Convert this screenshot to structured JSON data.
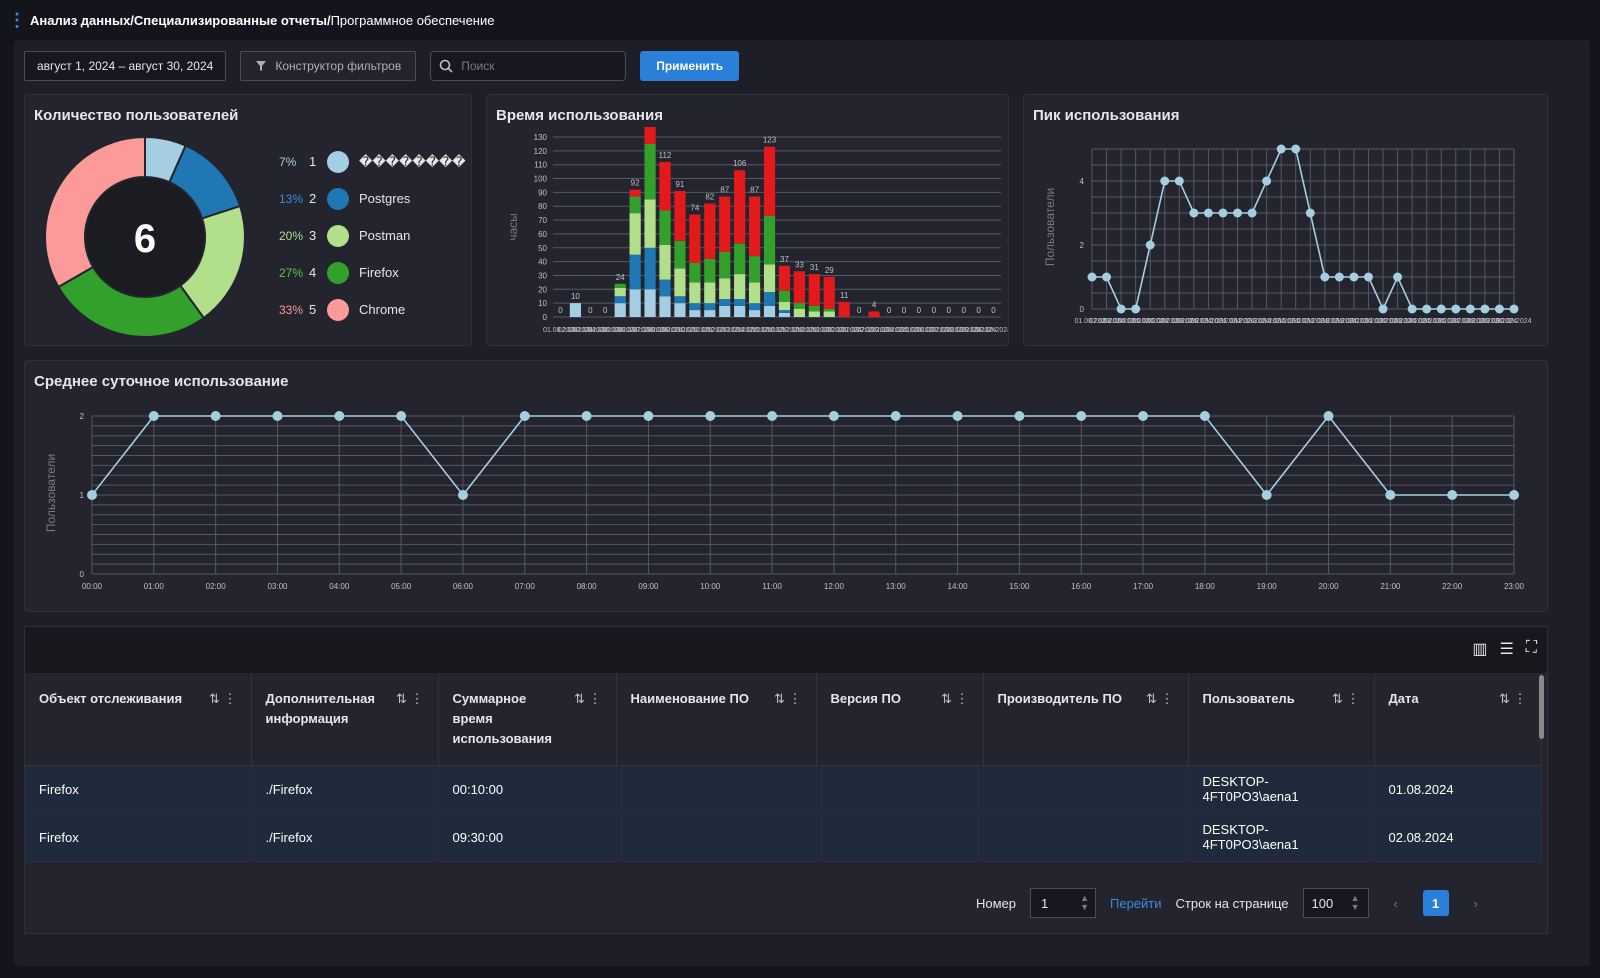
{
  "breadcrumb": {
    "path": "Анализ данных/Специализированные отчеты/",
    "current": "Программное обеспечение"
  },
  "toolbar": {
    "date_range": "август 1, 2024 – август 30, 2024",
    "filter_label": "Конструктор фильтров",
    "search_placeholder": "Поиск",
    "apply_label": "Применить"
  },
  "users_card": {
    "title": "Количество пользователей",
    "total": "6",
    "items": [
      {
        "pct": "7%",
        "num": "1",
        "name": "��������",
        "color": "#a6cee3"
      },
      {
        "pct": "13%",
        "num": "2",
        "name": "Postgres",
        "color": "#1f78b4"
      },
      {
        "pct": "20%",
        "num": "3",
        "name": "Postman",
        "color": "#b2df8a"
      },
      {
        "pct": "27%",
        "num": "4",
        "name": "Firefox",
        "color": "#33a02c"
      },
      {
        "pct": "33%",
        "num": "5",
        "name": "Chrome",
        "color": "#fb9a99"
      }
    ]
  },
  "usage_card": {
    "title": "Время использования",
    "ylabel": "часы"
  },
  "peak_card": {
    "title": "Пик использования",
    "ylabel": "Пользователи"
  },
  "daily_card": {
    "title": "Среднее суточное использование",
    "ylabel": "Пользователи"
  },
  "chart_data": [
    {
      "type": "pie",
      "labels": [
        "��������",
        "Postgres",
        "Postman",
        "Firefox",
        "Chrome"
      ],
      "values": [
        1,
        2,
        3,
        4,
        5
      ],
      "center_text": "6"
    },
    {
      "type": "bar",
      "stacked": true,
      "ylabel": "часы",
      "ylim": [
        0,
        130
      ],
      "yticks": [
        0,
        10,
        20,
        30,
        40,
        50,
        60,
        70,
        80,
        90,
        100,
        110,
        120,
        130
      ],
      "first_xlabel": "01.08.2024",
      "totals": [
        0,
        10,
        0,
        0,
        24,
        92,
        139,
        112,
        91,
        74,
        82,
        87,
        106,
        87,
        123,
        37,
        33,
        31,
        29,
        11,
        0,
        4,
        0,
        0,
        0,
        0,
        0,
        0,
        0,
        0
      ],
      "series": [
        {
          "name": "��������",
          "color": "#a6cee3",
          "values": [
            0,
            10,
            0,
            0,
            10,
            20,
            20,
            15,
            10,
            5,
            5,
            8,
            8,
            5,
            8,
            3,
            0,
            0,
            0,
            0,
            0,
            0,
            0,
            0,
            0,
            0,
            0,
            0,
            0,
            0
          ]
        },
        {
          "name": "Postgres",
          "color": "#1f78b4",
          "values": [
            0,
            0,
            0,
            0,
            5,
            25,
            30,
            12,
            5,
            5,
            5,
            5,
            5,
            5,
            10,
            2,
            0,
            0,
            0,
            0,
            0,
            0,
            0,
            0,
            0,
            0,
            0,
            0,
            0,
            0
          ]
        },
        {
          "name": "Postman",
          "color": "#b2df8a",
          "values": [
            0,
            0,
            0,
            0,
            6,
            30,
            35,
            25,
            20,
            15,
            15,
            15,
            18,
            15,
            20,
            6,
            6,
            4,
            4,
            0,
            0,
            0,
            0,
            0,
            0,
            0,
            0,
            0,
            0,
            0
          ]
        },
        {
          "name": "Firefox",
          "color": "#33a02c",
          "values": [
            0,
            0,
            0,
            0,
            3,
            12,
            40,
            25,
            20,
            14,
            17,
            19,
            22,
            19,
            35,
            8,
            4,
            4,
            2,
            0,
            0,
            0,
            0,
            0,
            0,
            0,
            0,
            0,
            0,
            0
          ]
        },
        {
          "name": "Chrome",
          "color": "#e31a1c",
          "values": [
            0,
            0,
            0,
            0,
            0,
            5,
            14,
            35,
            36,
            35,
            40,
            40,
            53,
            43,
            50,
            18,
            23,
            23,
            23,
            11,
            0,
            4,
            0,
            0,
            0,
            0,
            0,
            0,
            0,
            0
          ]
        }
      ]
    },
    {
      "type": "line",
      "ylabel": "Пользователи",
      "yticks": [
        0,
        2,
        4
      ],
      "ylim": [
        0,
        5
      ],
      "first_xlabel": "01.08.2024",
      "values": [
        1,
        1,
        0,
        0,
        2,
        4,
        4,
        3,
        3,
        3,
        3,
        3,
        4,
        5,
        5,
        3,
        1,
        1,
        1,
        1,
        0,
        1,
        0,
        0,
        0,
        0,
        0,
        0,
        0,
        0
      ]
    },
    {
      "type": "line",
      "ylabel": "Пользователи",
      "yticks": [
        0,
        1,
        2
      ],
      "ylim": [
        0,
        2
      ],
      "x": [
        "00:00",
        "01:00",
        "02:00",
        "03:00",
        "04:00",
        "05:00",
        "06:00",
        "07:00",
        "08:00",
        "09:00",
        "10:00",
        "11:00",
        "12:00",
        "13:00",
        "14:00",
        "15:00",
        "16:00",
        "17:00",
        "18:00",
        "19:00",
        "20:00",
        "21:00",
        "22:00",
        "23:00"
      ],
      "values": [
        1,
        2,
        2,
        2,
        2,
        2,
        1,
        2,
        2,
        2,
        2,
        2,
        2,
        2,
        2,
        2,
        2,
        2,
        2,
        1,
        2,
        1,
        1,
        1
      ]
    }
  ],
  "table": {
    "columns": [
      {
        "label": "Объект отслеживания",
        "sort": "⇅",
        "menu": "⋮"
      },
      {
        "label": "Дополнительная информация",
        "sort": "⇅",
        "menu": "⋮"
      },
      {
        "label": "Суммарное время использования",
        "sort": "⇅",
        "menu": "⋮"
      },
      {
        "label": "Наименование ПО",
        "sort": "⇅",
        "menu": "⋮"
      },
      {
        "label": "Версия ПО",
        "sort": "⇅",
        "menu": "⋮"
      },
      {
        "label": "Производитель ПО",
        "sort": "⇅",
        "menu": "⋮"
      },
      {
        "label": "Пользователь",
        "sort": "⇅",
        "menu": "⋮"
      },
      {
        "label": "Дата",
        "sort": "⇅",
        "menu": "⋮"
      }
    ],
    "rows": [
      [
        "Firefox",
        "./Firefox",
        "00:10:00",
        "",
        "",
        "",
        "DESKTOP-4FT0PO3\\aena1",
        "01.08.2024"
      ],
      [
        "Firefox",
        "./Firefox",
        "09:30:00",
        "",
        "",
        "",
        "DESKTOP-4FT0PO3\\aena1",
        "02.08.2024"
      ]
    ]
  },
  "pager": {
    "page_label": "Номер",
    "page_value": "1",
    "go_label": "Перейти",
    "size_label": "Строк на странице",
    "size_value": "100",
    "current_page": "1"
  }
}
